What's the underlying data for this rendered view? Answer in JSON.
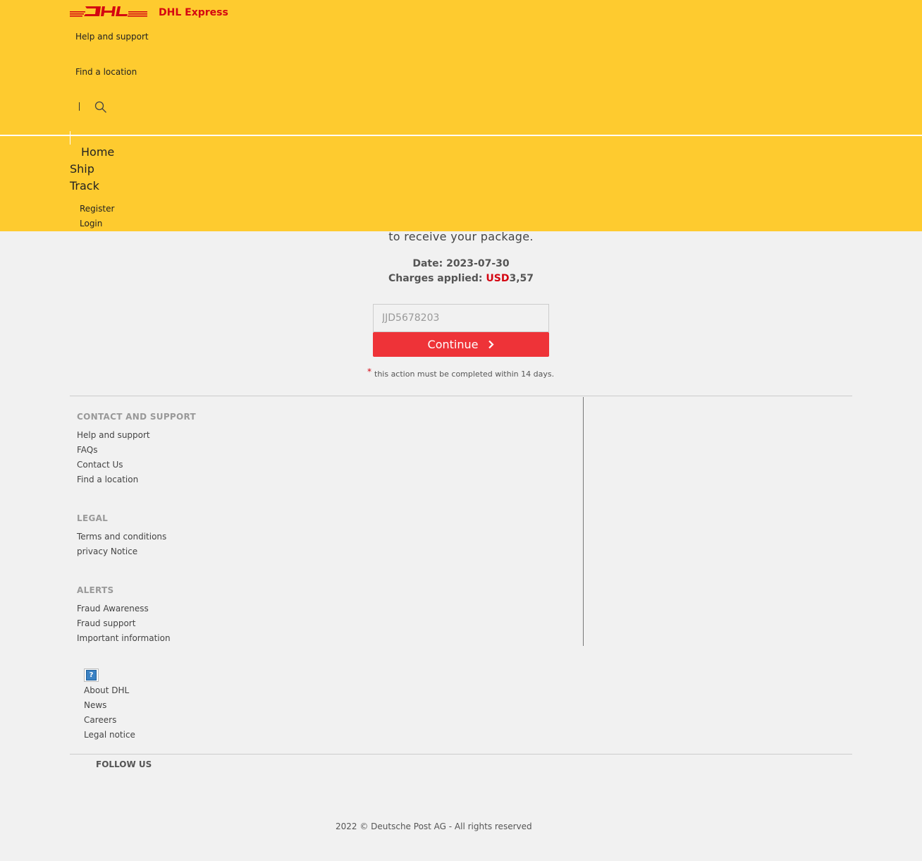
{
  "header": {
    "brand": "DHL Express",
    "util_links": [
      "Help and support",
      "Find a location"
    ],
    "main_nav": [
      "Home",
      "Ship",
      "Track"
    ],
    "account_links": [
      "Register",
      "Login"
    ]
  },
  "main": {
    "message_tail": "to receive your package.",
    "date_label": "Date:",
    "date_value": "2023-07-30",
    "charges_label": "Charges applied:",
    "currency": "USD",
    "amount": "3,57",
    "tracking_placeholder": "JJD5678203",
    "continue_label": "Continue",
    "asterisk": "*",
    "note": "this action must be completed within 14 days."
  },
  "footer": {
    "contact": {
      "heading": "CONTACT AND SUPPORT",
      "links": [
        "Help and support",
        "FAQs",
        "Contact Us",
        "Find a location"
      ]
    },
    "legal": {
      "heading": "LEGAL",
      "links": [
        "Terms and conditions",
        "privacy Notice"
      ]
    },
    "alerts": {
      "heading": "ALERTS",
      "links": [
        "Fraud Awareness",
        "Fraud support",
        "Important information"
      ]
    },
    "company_links": [
      "About DHL",
      "News",
      "Careers",
      "Legal notice"
    ],
    "follow_label": "FOLLOW US",
    "copyright": "2022 © Deutsche Post AG - All rights reserved"
  },
  "colors": {
    "header_bg": "#fecb2f",
    "brand_red": "#d40511",
    "button_red": "#ee3338",
    "page_bg": "#f1f1f1"
  },
  "icons": [
    "dhl-logo",
    "search-icon",
    "chevron-right-icon",
    "help-image-icon"
  ]
}
